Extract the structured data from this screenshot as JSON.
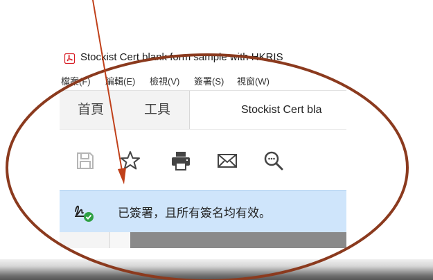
{
  "window": {
    "title": "Stockist Cert blank form sample with HKRIS",
    "app_icon": "pdf-reader-icon"
  },
  "menubar": {
    "items": [
      "檔案(F)",
      "編輯(E)",
      "檢視(V)",
      "簽署(S)",
      "視窗(W)"
    ]
  },
  "tabs": {
    "home": "首頁",
    "tools": "工具",
    "document": "Stockist Cert bla"
  },
  "toolbar": {
    "icons": [
      "save-icon",
      "star-icon",
      "print-icon",
      "mail-icon",
      "search-zoom-icon"
    ]
  },
  "signature_bar": {
    "message": "已簽署，且所有簽名均有效。",
    "icon": "signature-valid-icon"
  },
  "annotation": {
    "ellipse_color": "#8b3a1e",
    "arrow_color": "#c0401a"
  }
}
